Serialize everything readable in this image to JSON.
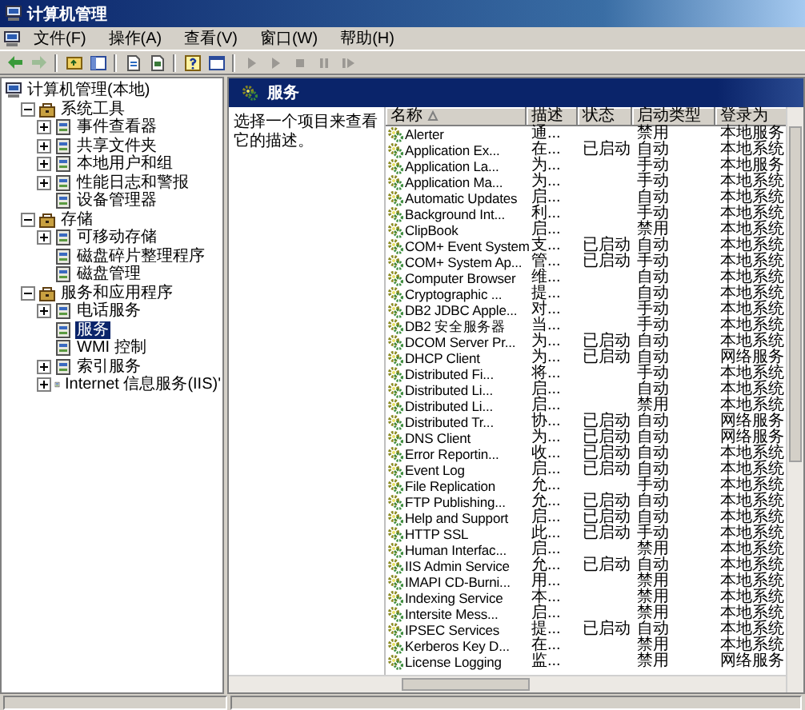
{
  "window": {
    "title": "计算机管理"
  },
  "menu": [
    "文件(F)",
    "操作(A)",
    "查看(V)",
    "窗口(W)",
    "帮助(H)"
  ],
  "toolbar_buttons": [
    {
      "disabled": false
    },
    {
      "disabled": true
    },
    {
      "disabled": false
    },
    {
      "disabled": false
    },
    {
      "disabled": false
    },
    {
      "disabled": false
    },
    {
      "disabled": false
    },
    {
      "disabled": false
    },
    {
      "disabled": true
    },
    {
      "disabled": true
    },
    {
      "disabled": true
    },
    {
      "disabled": true
    },
    {
      "disabled": true
    }
  ],
  "tree": [
    {
      "label": "计算机管理(本地)",
      "kind": "root",
      "selected": false,
      "children": [
        {
          "label": "系统工具",
          "kind": "node",
          "expanded": true,
          "selected": false,
          "children": [
            {
              "label": "事件查看器",
              "kind": "node",
              "expanded": false,
              "selected": false
            },
            {
              "label": "共享文件夹",
              "kind": "node",
              "expanded": false,
              "selected": false
            },
            {
              "label": "本地用户和组",
              "kind": "node",
              "expanded": false,
              "selected": false
            },
            {
              "label": "性能日志和警报",
              "kind": "node",
              "expanded": false,
              "selected": false
            },
            {
              "label": "设备管理器",
              "kind": "leaf",
              "selected": false
            }
          ]
        },
        {
          "label": "存储",
          "kind": "node",
          "expanded": true,
          "selected": false,
          "children": [
            {
              "label": "可移动存储",
              "kind": "node",
              "expanded": false,
              "selected": false
            },
            {
              "label": "磁盘碎片整理程序",
              "kind": "leaf",
              "selected": false
            },
            {
              "label": "磁盘管理",
              "kind": "leaf",
              "selected": false
            }
          ]
        },
        {
          "label": "服务和应用程序",
          "kind": "node",
          "expanded": true,
          "selected": false,
          "children": [
            {
              "label": "电话服务",
              "kind": "node",
              "expanded": false,
              "selected": false
            },
            {
              "label": "服务",
              "kind": "leaf",
              "selected": true
            },
            {
              "label": "WMI 控制",
              "kind": "leaf",
              "selected": false
            },
            {
              "label": "索引服务",
              "kind": "node",
              "expanded": false,
              "selected": false
            },
            {
              "label": "Internet 信息服务(IIS)'",
              "kind": "node",
              "expanded": false,
              "selected": false
            }
          ]
        }
      ]
    }
  ],
  "panel": {
    "title": "服务",
    "description": "选择一个项目来查看它的描述。"
  },
  "columns": [
    {
      "label": "名称",
      "sorted": true
    },
    {
      "label": "描述",
      "sorted": false
    },
    {
      "label": "状态",
      "sorted": false
    },
    {
      "label": "启动类型",
      "sorted": false
    },
    {
      "label": "登录为",
      "sorted": false
    }
  ],
  "services": [
    {
      "name": "Alerter",
      "description": "通...",
      "startup": "禁用",
      "logon": "本地服务"
    },
    {
      "name": "Application Ex...",
      "description": "在...",
      "status": "已启动",
      "startup": "自动",
      "logon": "本地系统"
    },
    {
      "name": "Application La...",
      "description": "为...",
      "startup": "手动",
      "logon": "本地服务"
    },
    {
      "name": "Application Ma...",
      "description": "为...",
      "startup": "手动",
      "logon": "本地系统"
    },
    {
      "name": "Automatic Updates",
      "description": "启...",
      "startup": "自动",
      "logon": "本地系统"
    },
    {
      "name": "Background Int...",
      "description": "利...",
      "startup": "手动",
      "logon": "本地系统"
    },
    {
      "name": "ClipBook",
      "description": "启...",
      "startup": "禁用",
      "logon": "本地系统"
    },
    {
      "name": "COM+ Event System",
      "description": "支...",
      "status": "已启动",
      "startup": "自动",
      "logon": "本地系统"
    },
    {
      "name": "COM+ System Ap...",
      "description": "管...",
      "status": "已启动",
      "startup": "手动",
      "logon": "本地系统"
    },
    {
      "name": "Computer Browser",
      "description": "维...",
      "startup": "自动",
      "logon": "本地系统"
    },
    {
      "name": "Cryptographic ...",
      "description": "提...",
      "startup": "自动",
      "logon": "本地系统"
    },
    {
      "name": "DB2 JDBC Apple...",
      "description": "对...",
      "startup": "手动",
      "logon": "本地系统"
    },
    {
      "name": "DB2 安全服务器",
      "description": "当...",
      "startup": "手动",
      "logon": "本地系统"
    },
    {
      "name": "DCOM Server Pr...",
      "description": "为...",
      "status": "已启动",
      "startup": "自动",
      "logon": "本地系统"
    },
    {
      "name": "DHCP Client",
      "description": "为...",
      "status": "已启动",
      "startup": "自动",
      "logon": "网络服务"
    },
    {
      "name": "Distributed Fi...",
      "description": "将...",
      "startup": "手动",
      "logon": "本地系统"
    },
    {
      "name": "Distributed Li...",
      "description": "启...",
      "startup": "自动",
      "logon": "本地系统"
    },
    {
      "name": "Distributed Li...",
      "description": "启...",
      "startup": "禁用",
      "logon": "本地系统"
    },
    {
      "name": "Distributed Tr...",
      "description": "协...",
      "status": "已启动",
      "startup": "自动",
      "logon": "网络服务"
    },
    {
      "name": "DNS Client",
      "description": "为...",
      "status": "已启动",
      "startup": "自动",
      "logon": "网络服务"
    },
    {
      "name": "Error Reportin...",
      "description": "收...",
      "status": "已启动",
      "startup": "自动",
      "logon": "本地系统"
    },
    {
      "name": "Event Log",
      "description": "启...",
      "status": "已启动",
      "startup": "自动",
      "logon": "本地系统"
    },
    {
      "name": "File Replication",
      "description": "允...",
      "startup": "手动",
      "logon": "本地系统"
    },
    {
      "name": "FTP Publishing...",
      "description": "允...",
      "status": "已启动",
      "startup": "自动",
      "logon": "本地系统"
    },
    {
      "name": "Help and Support",
      "description": "启...",
      "status": "已启动",
      "startup": "自动",
      "logon": "本地系统"
    },
    {
      "name": "HTTP SSL",
      "description": "此...",
      "status": "已启动",
      "startup": "手动",
      "logon": "本地系统"
    },
    {
      "name": "Human Interfac...",
      "description": "启...",
      "startup": "禁用",
      "logon": "本地系统"
    },
    {
      "name": "IIS Admin Service",
      "description": "允...",
      "status": "已启动",
      "startup": "自动",
      "logon": "本地系统"
    },
    {
      "name": "IMAPI CD-Burni...",
      "description": "用...",
      "startup": "禁用",
      "logon": "本地系统"
    },
    {
      "name": "Indexing Service",
      "description": "本...",
      "startup": "禁用",
      "logon": "本地系统"
    },
    {
      "name": "Intersite Mess...",
      "description": "启...",
      "startup": "禁用",
      "logon": "本地系统"
    },
    {
      "name": "IPSEC Services",
      "description": "提...",
      "status": "已启动",
      "startup": "自动",
      "logon": "本地系统"
    },
    {
      "name": "Kerberos Key D...",
      "description": "在...",
      "startup": "禁用",
      "logon": "本地系统"
    },
    {
      "name": "License Logging",
      "description": "监...",
      "startup": "禁用",
      "logon": "网络服务"
    }
  ]
}
